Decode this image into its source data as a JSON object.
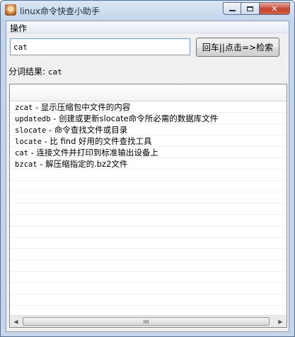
{
  "window": {
    "title": "linux命令快查小助手",
    "minimize_glyph": "",
    "close_glyph": "✕"
  },
  "menu": {
    "items": [
      "操作"
    ]
  },
  "search": {
    "value": "cat",
    "button_label": "回车||点击=>检索"
  },
  "segmentation": {
    "label": "分词结果:",
    "value": "cat"
  },
  "results": [
    {
      "cmd": "zcat",
      "sep": " - ",
      "desc": "显示压缩包中文件的内容"
    },
    {
      "cmd": "updatedb",
      "sep": " - ",
      "desc": "创建或更新slocate命令所必需的数据库文件"
    },
    {
      "cmd": "slocate",
      "sep": " - ",
      "desc": "命令查找文件或目录"
    },
    {
      "cmd": "locate",
      "sep": " - ",
      "desc": "比 find 好用的文件查找工具"
    },
    {
      "cmd": "cat",
      "sep": " - ",
      "desc": "连接文件并打印到标准输出设备上"
    },
    {
      "cmd": "bzcat",
      "sep": " - ",
      "desc": "解压缩指定的.bz2文件"
    }
  ],
  "scrollbar": {
    "left_arrow": "◀",
    "right_arrow": "▶"
  }
}
